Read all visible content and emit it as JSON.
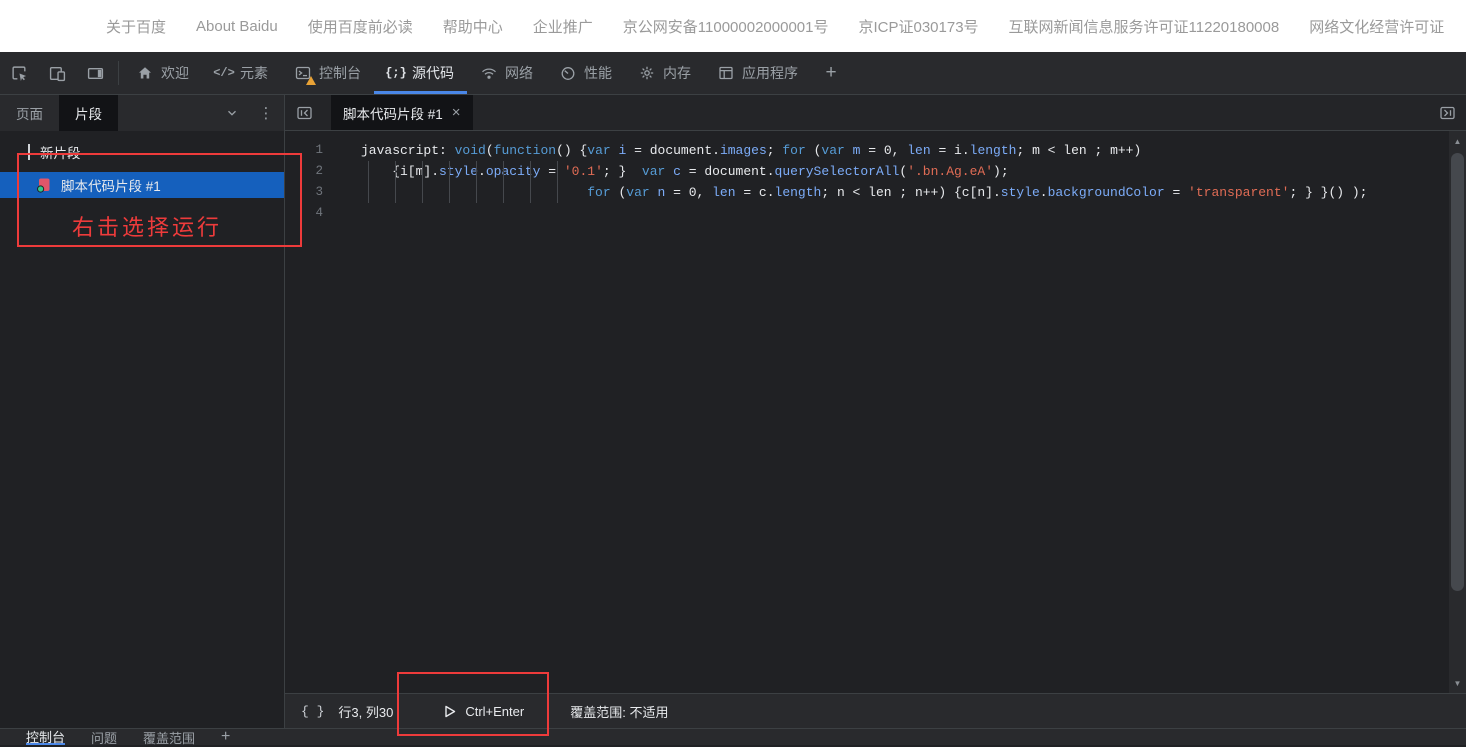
{
  "page": {
    "footer_links": [
      "关于百度",
      "About Baidu",
      "使用百度前必读",
      "帮助中心",
      "企业推广",
      "京公网安备11000002000001号",
      "京ICP证030173号",
      "互联网新闻信息服务许可证11220180008",
      "网络文化经营许可证"
    ]
  },
  "devtools": {
    "toolbar": {
      "tabs": [
        "欢迎",
        "元素",
        "控制台",
        "源代码",
        "网络",
        "性能",
        "内存",
        "应用程序"
      ],
      "more": "+"
    },
    "navigator": {
      "tabs": [
        "页面",
        "片段"
      ],
      "new_snippet": "新片段",
      "snippet": "脚本代码片段 #1"
    },
    "editor": {
      "tab": "脚本代码片段 #1",
      "close": "×",
      "code_lines": [
        {
          "num": "1",
          "tokens": [
            [
              "p",
              "javascript: "
            ],
            [
              "k",
              "void"
            ],
            [
              "p",
              "("
            ],
            [
              "k",
              "function"
            ],
            [
              "p",
              "() {"
            ],
            [
              "k",
              "var"
            ],
            [
              "p",
              " "
            ],
            [
              "d",
              "i"
            ],
            [
              "p",
              " = document."
            ],
            [
              "d",
              "images"
            ],
            [
              "p",
              "; "
            ],
            [
              "k",
              "for"
            ],
            [
              "p",
              " ("
            ],
            [
              "k",
              "var"
            ],
            [
              "p",
              " "
            ],
            [
              "d",
              "m"
            ],
            [
              "p",
              " = 0, "
            ],
            [
              "d",
              "len"
            ],
            [
              "p",
              " = i."
            ],
            [
              "d",
              "length"
            ],
            [
              "p",
              "; m < len ; m++)"
            ]
          ]
        },
        {
          "num": "2",
          "tokens": [
            [
              "p",
              "    {i[m]."
            ],
            [
              "d",
              "style"
            ],
            [
              "p",
              "."
            ],
            [
              "d",
              "opacity"
            ],
            [
              "p",
              " = "
            ],
            [
              "s",
              "'0.1'"
            ],
            [
              "p",
              "; }  "
            ],
            [
              "k",
              "var"
            ],
            [
              "p",
              " "
            ],
            [
              "d",
              "c"
            ],
            [
              "p",
              " = document."
            ],
            [
              "d",
              "querySelectorAll"
            ],
            [
              "p",
              "("
            ],
            [
              "s",
              "'.bn.Ag.eA'"
            ],
            [
              "p",
              ");"
            ]
          ]
        },
        {
          "num": "3",
          "tokens": [
            [
              "p",
              "                             "
            ],
            [
              "k",
              "for"
            ],
            [
              "p",
              " ("
            ],
            [
              "k",
              "var"
            ],
            [
              "p",
              " "
            ],
            [
              "d",
              "n"
            ],
            [
              "p",
              " = 0, "
            ],
            [
              "d",
              "len"
            ],
            [
              "p",
              " = c."
            ],
            [
              "d",
              "length"
            ],
            [
              "p",
              "; n < len ; n++) {c[n]."
            ],
            [
              "d",
              "style"
            ],
            [
              "p",
              "."
            ],
            [
              "d",
              "backgroundColor"
            ],
            [
              "p",
              " = "
            ],
            [
              "s",
              "'transparent'"
            ],
            [
              "p",
              "; } }() );"
            ]
          ]
        },
        {
          "num": "4",
          "tokens": []
        }
      ]
    },
    "status": {
      "pretty": "{ }",
      "position": "行3, 列30",
      "shortcut": "Ctrl+Enter",
      "coverage": "覆盖范围: 不适用"
    },
    "drawer": {
      "tabs": [
        "控制台",
        "问题",
        "覆盖范围"
      ],
      "more": "+"
    }
  },
  "annotations": {
    "hint": "右击选择运行"
  },
  "colors": {
    "accent_blue": "#4a87e8",
    "selection_blue": "#1560bd",
    "annotation_red": "#ee3b3b",
    "keyword": "#569cd6",
    "identifier": "#7cacf8",
    "string": "#e06c55",
    "warning_orange": "#e8a236"
  }
}
